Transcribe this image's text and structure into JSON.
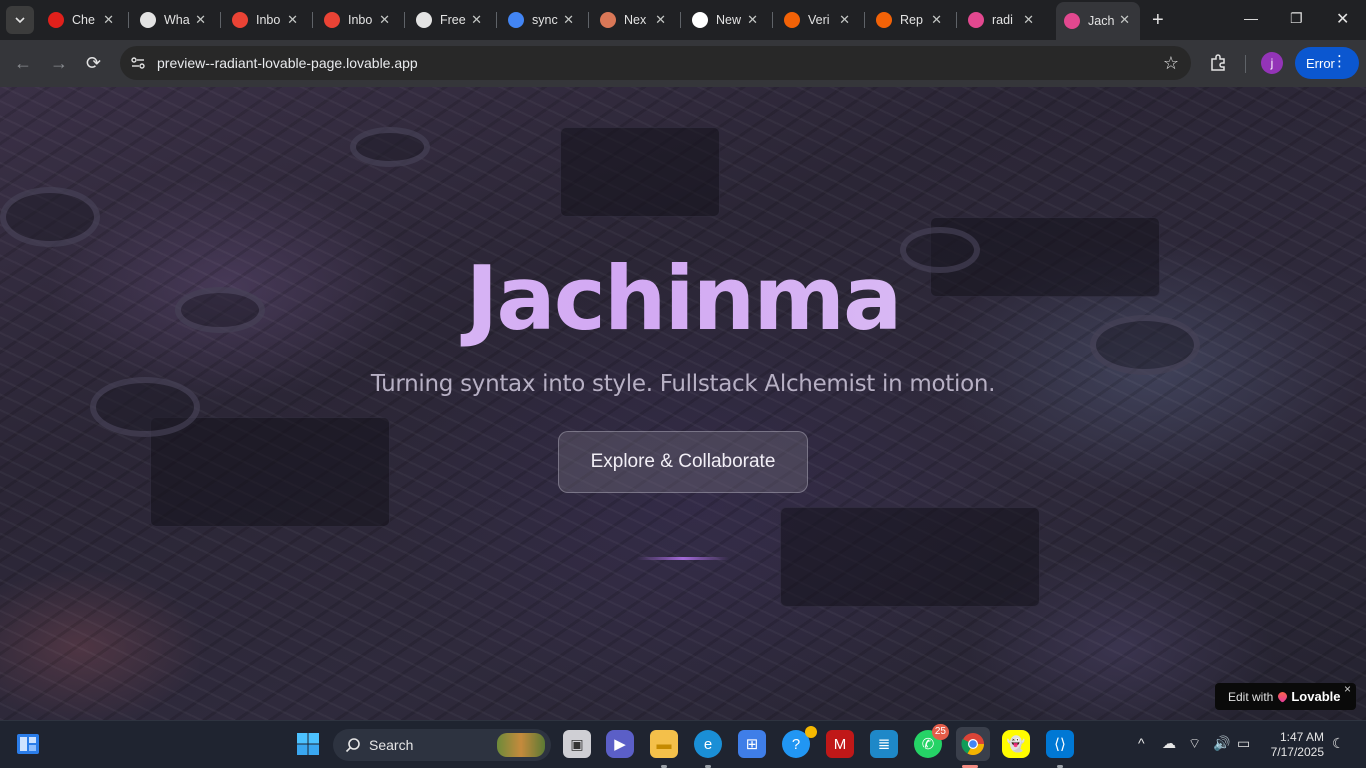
{
  "browser": {
    "tabs": [
      {
        "title": "Che",
        "icon": "opera-icon",
        "color": "#e0201b"
      },
      {
        "title": "Wha",
        "icon": "chatgpt-icon",
        "color": "#e3e3e3"
      },
      {
        "title": "Inbo",
        "icon": "gmail-icon",
        "color": "#ea4335"
      },
      {
        "title": "Inbo",
        "icon": "gmail-icon",
        "color": "#ea4335"
      },
      {
        "title": "Free",
        "icon": "github-icon",
        "color": "#e3e3e3"
      },
      {
        "title": "sync",
        "icon": "google-icon",
        "color": "#4285f4"
      },
      {
        "title": "Nex",
        "icon": "claude-icon",
        "color": "#d97757"
      },
      {
        "title": "New",
        "icon": "vercel-icon",
        "color": "#ffffff"
      },
      {
        "title": "Veri",
        "icon": "replit-icon",
        "color": "#f26207"
      },
      {
        "title": "Rep",
        "icon": "replit-icon",
        "color": "#f26207"
      },
      {
        "title": "radi",
        "icon": "lovable-icon",
        "color": "#e2488f"
      },
      {
        "title": "Jach",
        "icon": "lovable-icon",
        "color": "#e2488f",
        "active": true
      }
    ],
    "url": "preview--radiant-lovable-page.lovable.app",
    "profile_initial": "j",
    "error_label": "Error"
  },
  "page": {
    "title": "Jachinma",
    "tagline": "Turning syntax into style. Fullstack Alchemist in motion.",
    "cta_label": "Explore & Collaborate",
    "badge": {
      "prefix": "Edit with",
      "brand": "Lovable",
      "close": "×"
    }
  },
  "taskbar": {
    "search_label": "Search",
    "whatsapp_badge": "25",
    "time": "1:47 AM",
    "date": "7/17/2025"
  },
  "colors": {
    "accent": "#0b57d0",
    "title_gradient_start": "#e6d6f7",
    "title_gradient_mid": "#d2a8f3",
    "scroll_indicator": "#a36ad8"
  }
}
